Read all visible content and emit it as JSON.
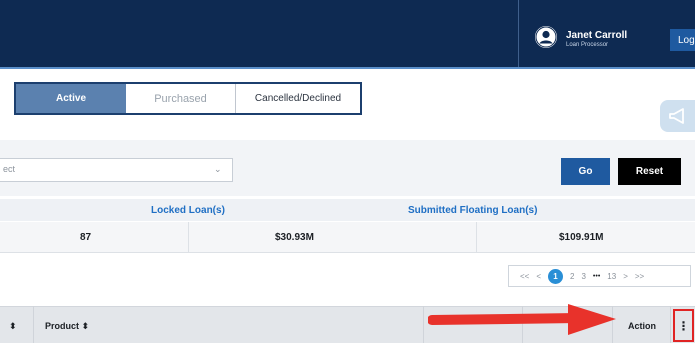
{
  "header": {
    "user_name": "Janet Carroll",
    "user_role": "Loan Processor",
    "logout_label": "Logout"
  },
  "tabs": [
    {
      "label": "Active"
    },
    {
      "label": "Purchased"
    },
    {
      "label": "Cancelled/Declined"
    }
  ],
  "filter": {
    "select_value": "ect",
    "go_label": "Go",
    "reset_label": "Reset"
  },
  "summary": {
    "headers": [
      "Locked Loan(s)",
      "Submitted Floating Loan(s)"
    ],
    "values": [
      "87",
      "$30.93M",
      "$109.91M"
    ]
  },
  "pagination": {
    "first": "<<",
    "prev": "<",
    "pages": [
      "1",
      "2",
      "3"
    ],
    "ellipsis": "•••",
    "last_page": "13",
    "next": ">",
    "last": ">>"
  },
  "table": {
    "sort_icon_lead": "⬍",
    "columns": [
      "Product ⬍",
      "Action"
    ],
    "kebab": "⋮"
  },
  "colors": {
    "header_bg": "#0e2a52",
    "accent_blue": "#1f5aa0",
    "link_blue": "#1f6fc4",
    "annotation_red": "#e02424"
  }
}
